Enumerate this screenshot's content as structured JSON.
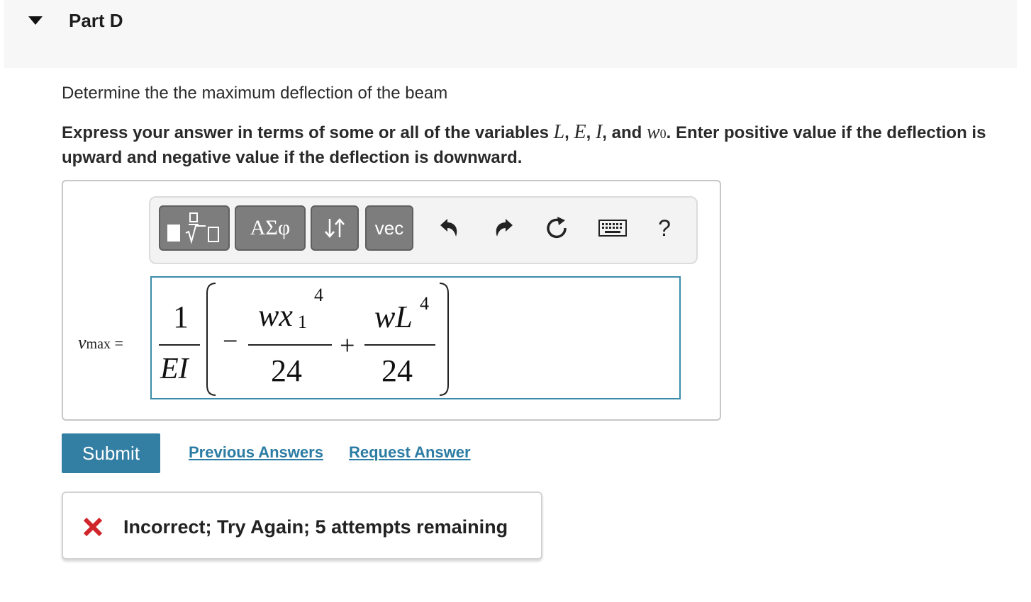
{
  "part": {
    "title": "Part D"
  },
  "question": {
    "instruction": "Determine the the maximum deflection of the beam",
    "express_pre": "Express your answer in terms of some or all of the variables ",
    "var_L": "L",
    "var_E": "E",
    "var_I": "I",
    "sep": ", ",
    "and": ", and ",
    "var_w": "w",
    "var_w_sub": "0",
    "express_post": ". Enter positive value if the deflection is upward and negative value if the deflection is downward."
  },
  "toolbar": {
    "greek_label": "ΑΣφ",
    "vec_label": "vec",
    "help_label": "?",
    "icons": [
      "templates-icon",
      "greek-letters-icon",
      "swap-arrows-icon",
      "vector-icon",
      "undo-icon",
      "redo-icon",
      "reset-icon",
      "keyboard-icon",
      "help-icon"
    ]
  },
  "answer": {
    "lhs_var": "v",
    "lhs_sub": "max",
    "lhs_eq": " =",
    "expr": {
      "outer_num": "1",
      "outer_den": "EI",
      "minus": "−",
      "frac1_num_base": "wx",
      "frac1_num_sub": "1",
      "frac1_num_exp": "4",
      "frac1_den": "24",
      "plus": "+",
      "frac2_num_base": "wL",
      "frac2_num_exp": "4",
      "frac2_den": "24"
    }
  },
  "actions": {
    "submit_label": "Submit",
    "previous_answers_label": "Previous Answers",
    "request_answer_label": "Request Answer"
  },
  "feedback": {
    "text": "Incorrect; Try Again; 5 attempts remaining",
    "status_color": "#d0252b"
  },
  "colors": {
    "accent": "#337fa3",
    "link": "#2c7ca3",
    "field_border": "#3b8cab"
  }
}
